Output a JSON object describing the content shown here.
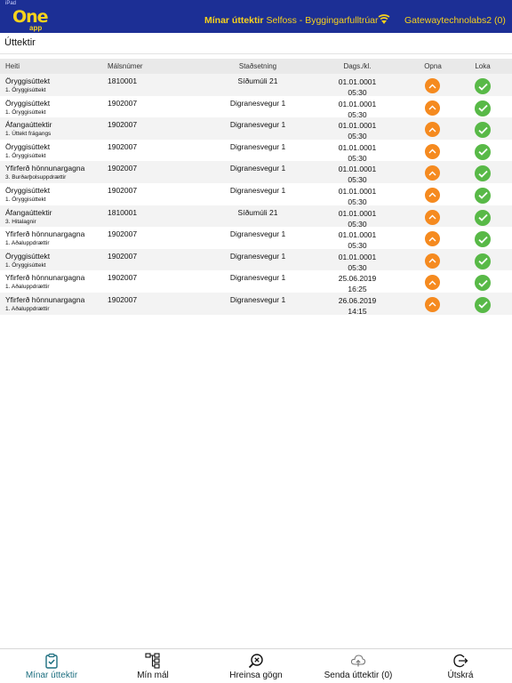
{
  "status_bar": {
    "left": "iPad",
    "center": "",
    "right": ""
  },
  "app_bar": {
    "logo_text": "One",
    "logo_sub": "app",
    "title_strong": "Mínar úttektir",
    "title_rest": "Selfoss - Byggingarfulltrúar",
    "user": "Gatewaytechnolabs2",
    "user_count": "(0)",
    "network_icon": "wifi-signal-icon",
    "brand_color": "#1c2f95",
    "accent_color": "#f7d21c"
  },
  "page": {
    "title": "Úttektir"
  },
  "table": {
    "headers": {
      "name": "Heiti",
      "case_no": "Málsnúmer",
      "location": "Staðsetning",
      "date": "Dags./kl.",
      "open": "Opna",
      "close": "Loka"
    },
    "rows": [
      {
        "name": "Öryggisúttekt",
        "sub": "1. Öryggisúttekt",
        "case_no": "1810001",
        "location": "Síðumúli 21",
        "date": "01.01.0001",
        "time": "05:30"
      },
      {
        "name": "Öryggisúttekt",
        "sub": "1. Öryggisúttekt",
        "case_no": "1902007",
        "location": "Digranesvegur 1",
        "date": "01.01.0001",
        "time": "05:30"
      },
      {
        "name": "Áfangaúttektir",
        "sub": "1. Úttekt frágangs",
        "case_no": "1902007",
        "location": "Digranesvegur 1",
        "date": "01.01.0001",
        "time": "05:30"
      },
      {
        "name": "Öryggisúttekt",
        "sub": "1. Öryggisúttekt",
        "case_no": "1902007",
        "location": "Digranesvegur 1",
        "date": "01.01.0001",
        "time": "05:30"
      },
      {
        "name": "Yfirferð hönnunargagna",
        "sub": "3. Burðarþolsuppdrættir",
        "case_no": "1902007",
        "location": "Digranesvegur 1",
        "date": "01.01.0001",
        "time": "05:30"
      },
      {
        "name": "Öryggisúttekt",
        "sub": "1. Öryggisúttekt",
        "case_no": "1902007",
        "location": "Digranesvegur 1",
        "date": "01.01.0001",
        "time": "05:30"
      },
      {
        "name": "Áfangaúttektir",
        "sub": "3. Hitalagnir",
        "case_no": "1810001",
        "location": "Síðumúli 21",
        "date": "01.01.0001",
        "time": "05:30"
      },
      {
        "name": "Yfirferð hönnunargagna",
        "sub": "1. Aðaluppdrættir",
        "case_no": "1902007",
        "location": "Digranesvegur 1",
        "date": "01.01.0001",
        "time": "05:30"
      },
      {
        "name": "Öryggisúttekt",
        "sub": "1. Öryggisúttekt",
        "case_no": "1902007",
        "location": "Digranesvegur 1",
        "date": "01.01.0001",
        "time": "05:30"
      },
      {
        "name": "Yfirferð hönnunargagna",
        "sub": "1. Aðaluppdrættir",
        "case_no": "1902007",
        "location": "Digranesvegur 1",
        "date": "25.06.2019",
        "time": "16:25"
      },
      {
        "name": "Yfirferð hönnunargagna",
        "sub": "1. Aðaluppdrættir",
        "case_no": "1902007",
        "location": "Digranesvegur 1",
        "date": "26.06.2019",
        "time": "14:15"
      }
    ],
    "open_icon": "chevron-up-icon",
    "close_icon": "checkmark-icon",
    "open_color": "#f58a1f",
    "close_color": "#58b947"
  },
  "tabs": [
    {
      "label": "Mínar úttektir",
      "icon": "clipboard-check-icon",
      "active": true
    },
    {
      "label": "Mín mál",
      "icon": "hierarchy-icon",
      "active": false
    },
    {
      "label": "Hreinsa gögn",
      "icon": "search-clear-icon",
      "active": false
    },
    {
      "label": "Senda úttektir (0)",
      "icon": "cloud-upload-icon",
      "active": false
    },
    {
      "label": "Útskrá",
      "icon": "logout-icon",
      "active": false
    }
  ]
}
